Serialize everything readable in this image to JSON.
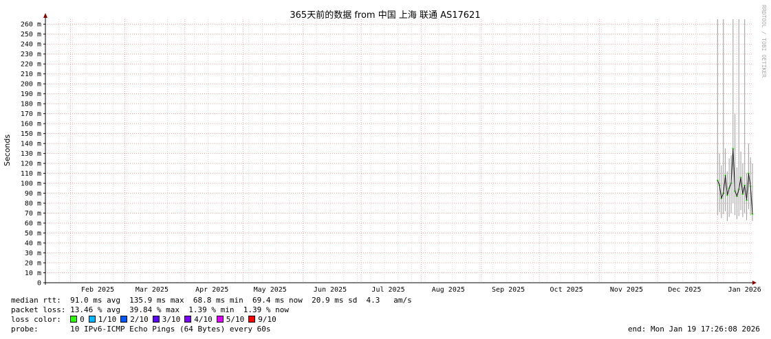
{
  "chart_data": {
    "type": "line",
    "title": "365天前的数据 from 中国 上海 联通 AS17621",
    "ylabel": "Seconds",
    "ylim": [
      0,
      0.265
    ],
    "y_ticks": [
      "0",
      "10 m",
      "20 m",
      "30 m",
      "40 m",
      "50 m",
      "60 m",
      "70 m",
      "80 m",
      "90 m",
      "100 m",
      "110 m",
      "120 m",
      "130 m",
      "140 m",
      "150 m",
      "160 m",
      "170 m",
      "180 m",
      "190 m",
      "200 m",
      "210 m",
      "220 m",
      "230 m",
      "240 m",
      "250 m",
      "260 m"
    ],
    "x_range": [
      "2025-01-19",
      "2026-01-19"
    ],
    "x_ticks": [
      {
        "label": "Feb 2025",
        "date": "2025-02-15"
      },
      {
        "label": "Mar 2025",
        "date": "2025-03-15"
      },
      {
        "label": "Apr 2025",
        "date": "2025-04-15"
      },
      {
        "label": "May 2025",
        "date": "2025-05-15"
      },
      {
        "label": "Jun 2025",
        "date": "2025-06-15"
      },
      {
        "label": "Jul 2025",
        "date": "2025-07-15"
      },
      {
        "label": "Aug 2025",
        "date": "2025-08-15"
      },
      {
        "label": "Sep 2025",
        "date": "2025-09-15"
      },
      {
        "label": "Oct 2025",
        "date": "2025-10-15"
      },
      {
        "label": "Nov 2025",
        "date": "2025-11-15"
      },
      {
        "label": "Dec 2025",
        "date": "2025-12-15"
      },
      {
        "label": "Jan 2026",
        "date": "2026-01-15"
      }
    ],
    "grid": true,
    "series": [
      {
        "color": "#1a1a1a",
        "points": [
          {
            "x": "2026-01-01",
            "median": 0.103,
            "min": 0.068,
            "max": 0.265
          },
          {
            "x": "2026-01-02",
            "median": 0.098,
            "min": 0.071,
            "max": 0.13
          },
          {
            "x": "2026-01-03",
            "median": 0.085,
            "min": 0.065,
            "max": 0.118
          },
          {
            "x": "2026-01-04",
            "median": 0.09,
            "min": 0.069,
            "max": 0.265
          },
          {
            "x": "2026-01-05",
            "median": 0.108,
            "min": 0.072,
            "max": 0.135
          },
          {
            "x": "2026-01-06",
            "median": 0.088,
            "min": 0.062,
            "max": 0.112
          },
          {
            "x": "2026-01-07",
            "median": 0.095,
            "min": 0.066,
            "max": 0.125
          },
          {
            "x": "2026-01-08",
            "median": 0.1,
            "min": 0.07,
            "max": 0.128
          },
          {
            "x": "2026-01-09",
            "median": 0.135,
            "min": 0.08,
            "max": 0.265
          },
          {
            "x": "2026-01-10",
            "median": 0.092,
            "min": 0.068,
            "max": 0.17
          },
          {
            "x": "2026-01-11",
            "median": 0.087,
            "min": 0.064,
            "max": 0.116
          },
          {
            "x": "2026-01-12",
            "median": 0.094,
            "min": 0.067,
            "max": 0.265
          },
          {
            "x": "2026-01-13",
            "median": 0.106,
            "min": 0.073,
            "max": 0.132
          },
          {
            "x": "2026-01-14",
            "median": 0.089,
            "min": 0.066,
            "max": 0.12
          },
          {
            "x": "2026-01-15",
            "median": 0.098,
            "min": 0.07,
            "max": 0.265
          },
          {
            "x": "2026-01-16",
            "median": 0.083,
            "min": 0.063,
            "max": 0.11
          },
          {
            "x": "2026-01-17",
            "median": 0.11,
            "min": 0.074,
            "max": 0.14
          },
          {
            "x": "2026-01-18",
            "median": 0.097,
            "min": 0.068,
            "max": 0.126
          },
          {
            "x": "2026-01-19",
            "median": 0.069,
            "min": 0.062,
            "max": 0.12
          }
        ]
      }
    ]
  },
  "watermark": "RRDTOOL / TOBI OETIKER",
  "stats": {
    "median_rtt": "median rtt:  91.0 ms avg  135.9 ms max  68.8 ms min  69.4 ms now  20.9 ms sd  4.3   am/s",
    "packet_loss": "packet loss: 13.46 % avg  39.84 % max  1.39 % min  1.39 % now",
    "loss_color_label": "loss color:",
    "loss_colors": [
      {
        "label": "0",
        "color": "#26ff00"
      },
      {
        "label": "1/10",
        "color": "#00b8ff"
      },
      {
        "label": "2/10",
        "color": "#0059ff"
      },
      {
        "label": "3/10",
        "color": "#5e00ff"
      },
      {
        "label": "4/10",
        "color": "#7e00ff"
      },
      {
        "label": "5/10",
        "color": "#dd00ff"
      },
      {
        "label": "9/10",
        "color": "#ff0000"
      }
    ],
    "probe": "probe:       10 IPv6-ICMP Echo Pings (64 Bytes) every 60s",
    "end": "end: Mon Jan 19 17:26:08 2026"
  }
}
